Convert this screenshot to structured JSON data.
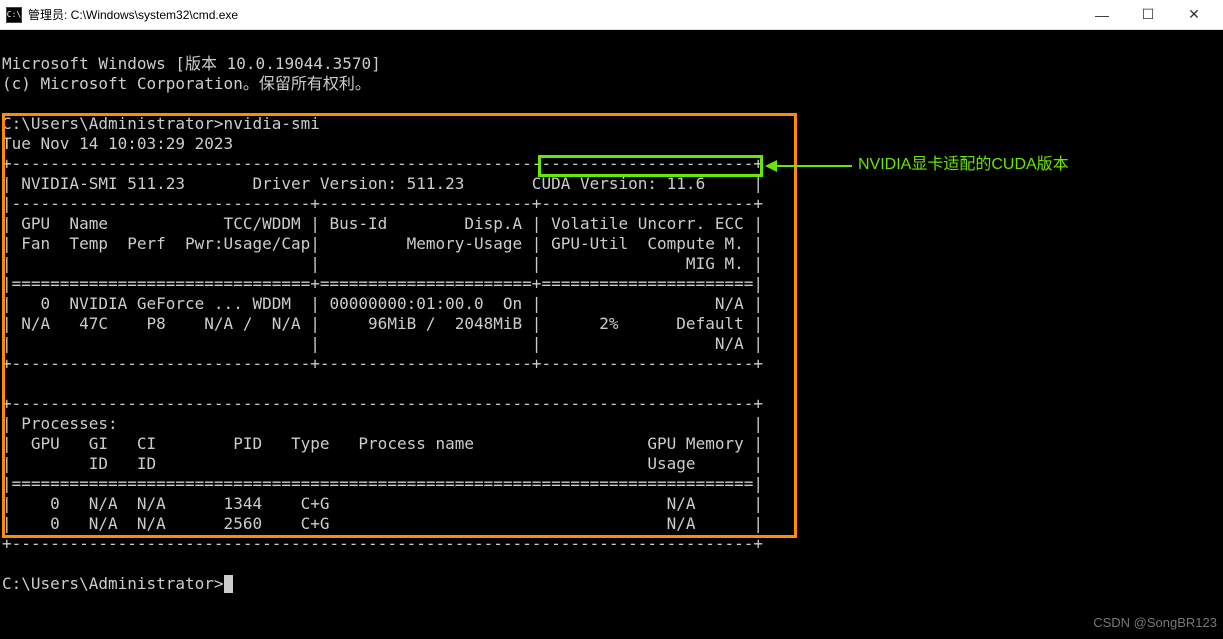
{
  "window": {
    "title": "管理员: C:\\Windows\\system32\\cmd.exe"
  },
  "terminal": {
    "line1": "Microsoft Windows [版本 10.0.19044.3570]",
    "line2": "(c) Microsoft Corporation。保留所有权利。",
    "prompt1": "C:\\Users\\Administrator>nvidia-smi",
    "date": "Tue Nov 14 10:03:29 2023",
    "top_border": "+-----------------------------------------------------------------------------+",
    "header": "| NVIDIA-SMI 511.23       Driver Version: 511.23       CUDA Version: 11.6     |",
    "sep1": "|-------------------------------+----------------------+----------------------+",
    "col_head1": "| GPU  Name            TCC/WDDM | Bus-Id        Disp.A | Volatile Uncorr. ECC |",
    "col_head2": "| Fan  Temp  Perf  Pwr:Usage/Cap|         Memory-Usage | GPU-Util  Compute M. |",
    "col_head3": "|                               |                      |               MIG M. |",
    "sep2": "|===============================+======================+======================|",
    "gpu_row1": "|   0  NVIDIA GeForce ... WDDM  | 00000000:01:00.0  On |                  N/A |",
    "gpu_row2": "| N/A   47C    P8    N/A /  N/A |     96MiB /  2048MiB |      2%      Default |",
    "gpu_row3": "|                               |                      |                  N/A |",
    "sep3": "+-------------------------------+----------------------+----------------------+",
    "blank_border": "                                                                               ",
    "proc_top": "+-----------------------------------------------------------------------------+",
    "proc_head": "| Processes:                                                                  |",
    "proc_cols1": "|  GPU   GI   CI        PID   Type   Process name                  GPU Memory |",
    "proc_cols2": "|        ID   ID                                                   Usage      |",
    "proc_sep": "|=============================================================================|",
    "proc_row1": "|    0   N/A  N/A      1344    C+G                                   N/A      |",
    "proc_row2": "|    0   N/A  N/A      2560    C+G                                   N/A      |",
    "proc_bot": "+-----------------------------------------------------------------------------+",
    "prompt2": "C:\\Users\\Administrator>"
  },
  "annotation": {
    "text": "NVIDIA显卡适配的CUDA版本"
  },
  "watermark": "CSDN @SongBR123"
}
